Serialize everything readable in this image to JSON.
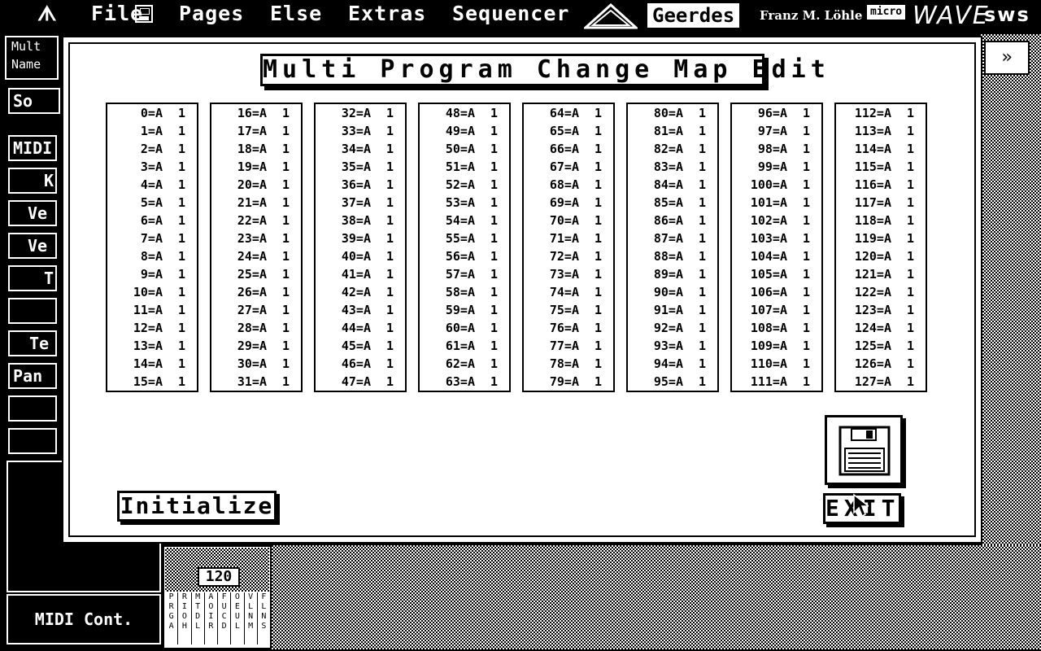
{
  "menubar": {
    "logo_glyph": "ᗑ",
    "items": [
      "File",
      "Pages",
      "Else",
      "Extras",
      "Sequencer"
    ],
    "brands": {
      "geerdes": "Geerdes",
      "author": "Franz M. Löhle",
      "micro": "micro",
      "wave": "WAVE",
      "sws": "sws"
    }
  },
  "sidebar": {
    "mult_name": [
      "Mult",
      "Name"
    ],
    "items": [
      "So",
      "MIDI",
      "K",
      "Ve",
      "Ve",
      "T",
      "",
      "Te",
      "Pan",
      "",
      ""
    ]
  },
  "bottom": {
    "midi_cont": "MIDI Cont.",
    "tempo": "120",
    "track_cols": [
      "PRGA",
      "RIOH",
      "MTDL",
      "AOIR",
      "FUCD",
      "OEUL",
      "VLNM",
      "FLNS",
      "SAUT",
      "UNIP"
    ]
  },
  "dialog": {
    "title": "Multi Program Change Map Edit",
    "initialize_label": "Initialize",
    "exit_label": "EXIT",
    "bank": "A",
    "value": "1",
    "columns": [
      [
        "0",
        "1",
        "2",
        "3",
        "4",
        "5",
        "6",
        "7",
        "8",
        "9",
        "10",
        "11",
        "12",
        "13",
        "14",
        "15"
      ],
      [
        "16",
        "17",
        "18",
        "19",
        "20",
        "21",
        "22",
        "23",
        "24",
        "25",
        "26",
        "27",
        "28",
        "29",
        "30",
        "31"
      ],
      [
        "32",
        "33",
        "34",
        "35",
        "36",
        "37",
        "38",
        "39",
        "40",
        "41",
        "42",
        "43",
        "44",
        "45",
        "46",
        "47"
      ],
      [
        "48",
        "49",
        "50",
        "51",
        "52",
        "53",
        "54",
        "55",
        "56",
        "57",
        "58",
        "59",
        "60",
        "61",
        "62",
        "63"
      ],
      [
        "64",
        "65",
        "66",
        "67",
        "68",
        "69",
        "70",
        "71",
        "72",
        "73",
        "74",
        "75",
        "76",
        "77",
        "78",
        "79"
      ],
      [
        "80",
        "81",
        "82",
        "83",
        "84",
        "85",
        "86",
        "87",
        "88",
        "89",
        "90",
        "91",
        "92",
        "93",
        "94",
        "95"
      ],
      [
        "96",
        "97",
        "98",
        "99",
        "100",
        "101",
        "102",
        "103",
        "104",
        "105",
        "106",
        "107",
        "108",
        "109",
        "110",
        "111"
      ],
      [
        "112",
        "113",
        "114",
        "115",
        "116",
        "117",
        "118",
        "119",
        "120",
        "121",
        "122",
        "123",
        "124",
        "125",
        "126",
        "127"
      ]
    ]
  }
}
